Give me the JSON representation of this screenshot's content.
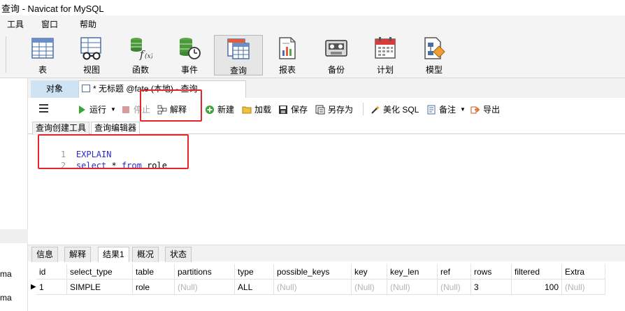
{
  "window": {
    "title": "查询 - Navicat for MySQL"
  },
  "menu": {
    "items": [
      "工具",
      "窗口",
      "帮助"
    ]
  },
  "toolbar": {
    "items": [
      {
        "label": "表",
        "icon": "table-icon"
      },
      {
        "label": "视图",
        "icon": "view-icon"
      },
      {
        "label": "函数",
        "icon": "function-icon"
      },
      {
        "label": "事件",
        "icon": "event-icon"
      },
      {
        "label": "查询",
        "icon": "query-icon",
        "active": true
      },
      {
        "label": "报表",
        "icon": "report-icon"
      },
      {
        "label": "备份",
        "icon": "backup-icon"
      },
      {
        "label": "计划",
        "icon": "schedule-icon"
      },
      {
        "label": "模型",
        "icon": "model-icon"
      }
    ]
  },
  "tabs": {
    "objects": "对象",
    "query": "* 无标题 @fate (本地) - 查询"
  },
  "query_toolbar": {
    "run": "运行",
    "stop": "停止",
    "explain": "解释",
    "new": "新建",
    "load": "加载",
    "save": "保存",
    "save_as": "另存为",
    "beautify": "美化 SQL",
    "comment": "备注",
    "export": "导出"
  },
  "subtabs": {
    "builder": "查询创建工具",
    "editor": "查询编辑器"
  },
  "editor": {
    "lines": [
      {
        "num": "1",
        "tokens": [
          {
            "t": "EXPLAIN",
            "kw": true
          }
        ]
      },
      {
        "num": "2",
        "tokens": [
          {
            "t": "select",
            "kw": true
          },
          {
            "t": " * ",
            "kw": false
          },
          {
            "t": "from",
            "kw": true
          },
          {
            "t": " role",
            "kw": false
          }
        ]
      }
    ]
  },
  "result_tabs": [
    "信息",
    "解释",
    "结果1",
    "概况",
    "状态"
  ],
  "result_active": "结果1",
  "grid": {
    "columns": [
      "id",
      "select_type",
      "table",
      "partitions",
      "type",
      "possible_keys",
      "key",
      "key_len",
      "ref",
      "rows",
      "filtered",
      "Extra"
    ],
    "rows": [
      [
        "1",
        "SIMPLE",
        "role",
        "(Null)",
        "ALL",
        "(Null)",
        "(Null)",
        "(Null)",
        "(Null)",
        "3",
        "100",
        "(Null)"
      ]
    ]
  },
  "left_panel": {
    "items": [
      "ma",
      "ma"
    ]
  },
  "colors": {
    "highlight": "#e2262c",
    "keyword": "#2a2ad0",
    "null_text": "#b3b3b3",
    "objects_tab": "#cfe3f3"
  }
}
